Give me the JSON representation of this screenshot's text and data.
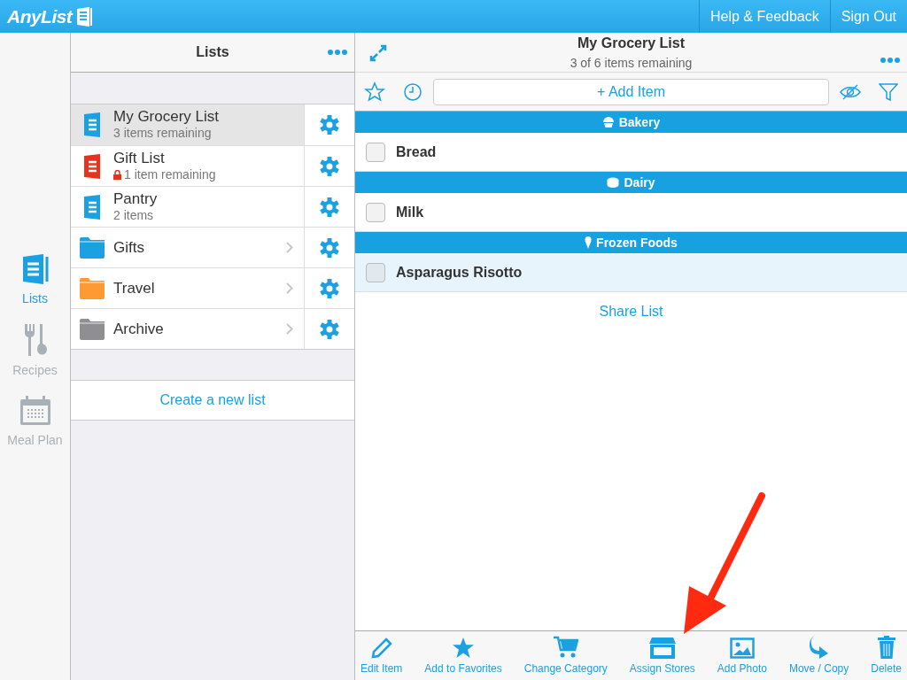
{
  "header": {
    "logo": "AnyList",
    "buttons": [
      "Help & Feedback",
      "Sign Out"
    ]
  },
  "nav": [
    {
      "kind": "lists",
      "label": "Lists",
      "selected": true
    },
    {
      "kind": "recipes",
      "label": "Recipes",
      "selected": false
    },
    {
      "kind": "mealplan",
      "label": "Meal Plan",
      "selected": false
    }
  ],
  "lists_panel": {
    "title": "Lists",
    "items": [
      {
        "kind": "list",
        "name": "My Grocery List",
        "subtitle": "3 items remaining",
        "color": "#1ba1e2",
        "locked": false,
        "selected": true
      },
      {
        "kind": "list",
        "name": "Gift List",
        "subtitle": "1 item remaining",
        "color": "#e8321e",
        "locked": true,
        "selected": false
      },
      {
        "kind": "list",
        "name": "Pantry",
        "subtitle": "2 items",
        "color": "#1ba1e2",
        "locked": false,
        "selected": false
      },
      {
        "kind": "folder",
        "name": "Gifts",
        "color": "#1ba1e2",
        "selected": false
      },
      {
        "kind": "folder",
        "name": "Travel",
        "color": "#ff9933",
        "selected": false
      },
      {
        "kind": "folder",
        "name": "Archive",
        "color": "#8e8e93",
        "selected": false
      }
    ],
    "create_link": "Create a new list"
  },
  "detail": {
    "title": "My Grocery List",
    "subtitle": "3 of 6 items remaining",
    "add_item": "+ Add Item",
    "sections": [
      {
        "kind": "bakery",
        "name": "Bakery",
        "items": [
          {
            "name": "Bread",
            "checked": false,
            "selected": false
          }
        ]
      },
      {
        "kind": "dairy",
        "name": "Dairy",
        "items": [
          {
            "name": "Milk",
            "checked": false,
            "selected": false
          }
        ]
      },
      {
        "kind": "frozen",
        "name": "Frozen Foods",
        "items": [
          {
            "name": "Asparagus Risotto",
            "checked": false,
            "selected": true
          }
        ]
      }
    ],
    "share_link": "Share List",
    "toolbar": [
      {
        "kind": "edit",
        "label": "Edit Item"
      },
      {
        "kind": "favorite",
        "label": "Add to Favorites"
      },
      {
        "kind": "category",
        "label": "Change Category"
      },
      {
        "kind": "stores",
        "label": "Assign Stores"
      },
      {
        "kind": "photo",
        "label": "Add Photo"
      },
      {
        "kind": "move",
        "label": "Move / Copy"
      },
      {
        "kind": "delete",
        "label": "Delete"
      }
    ]
  }
}
